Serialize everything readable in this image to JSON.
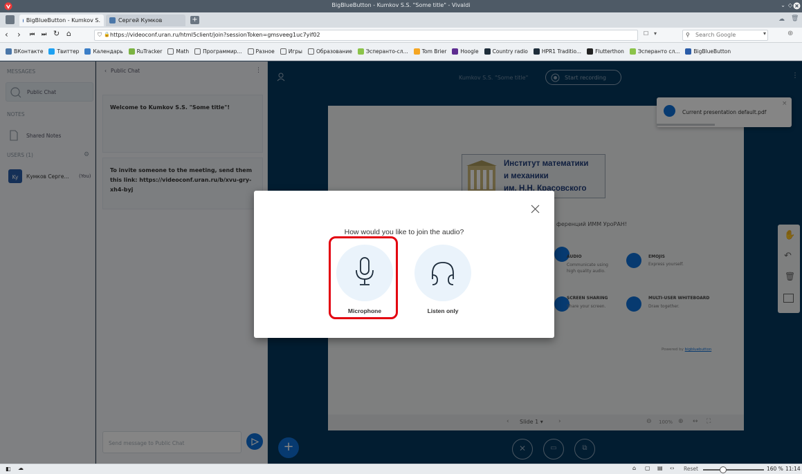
{
  "window": {
    "title": "BigBlueButton - Kumkov S.S. \"Some title\" - Vivaldi"
  },
  "tabs": [
    {
      "label": "BigBlueButton - Kumkov S.",
      "active": true
    },
    {
      "label": "Сергей Кумков",
      "active": false
    }
  ],
  "address": {
    "url": "https://videoconf.uran.ru/html5client/join?sessionToken=gmsveeg1uc7yif02",
    "search_placeholder": "Search Google"
  },
  "bookmarks": [
    {
      "label": "ВКонтакте",
      "color": "#4a76a8"
    },
    {
      "label": "Твиттер",
      "color": "#1da1f2"
    },
    {
      "label": "Календарь",
      "color": "#3b7ec7"
    },
    {
      "label": "RuTracker",
      "color": "#7bb342"
    },
    {
      "label": "Math",
      "color": "folder"
    },
    {
      "label": "Программир...",
      "color": "folder"
    },
    {
      "label": "Разное",
      "color": "folder"
    },
    {
      "label": "Игры",
      "color": "folder"
    },
    {
      "label": "Образование",
      "color": "folder"
    },
    {
      "label": "Эсперанто-сл...",
      "color": "#8bc34a"
    },
    {
      "label": "Tom Brier",
      "color": "#f5a623"
    },
    {
      "label": "Hoogle",
      "color": "#5e2d91"
    },
    {
      "label": "Country radio",
      "color": "#1e2d3a"
    },
    {
      "label": "HPR1 Traditio...",
      "color": "#1e2d3a"
    },
    {
      "label": "Flutterthon",
      "color": "#222222"
    },
    {
      "label": "Эсперанто сл...",
      "color": "#8bc34a"
    },
    {
      "label": "BigBlueButton",
      "color": "#2a5ca8"
    }
  ],
  "sidebar": {
    "messages_heading": "MESSAGES",
    "public_chat_label": "Public Chat",
    "notes_heading": "NOTES",
    "shared_notes_label": "Shared Notes",
    "users_heading": "USERS (1)",
    "user_avatar_text": "Ky",
    "user_name": "Кумков Серге...",
    "user_you": "(You)"
  },
  "chat": {
    "back_label": "Public Chat",
    "welcome_prefix": "Welcome to ",
    "welcome_title": "Kumkov S.S. \"Some title\"",
    "welcome_suffix": "!",
    "invite_text": "To invite someone to the meeting, send them this link: https://videoconf.uran.ru/b/xvu-gry-xh4-byj",
    "input_placeholder": "Send message to Public Chat"
  },
  "main": {
    "meeting_title": "Kumkov S.S. \"Some title\"",
    "recording_label": "Start recording",
    "slide_label": "Slide 1",
    "zoom_value": "100%"
  },
  "slide": {
    "institute_line1": "Институт математики",
    "institute_line2": "и механики",
    "institute_line3": "им. Н.Н. Красовского",
    "conference_text": "ференций ИММ УроРАН!",
    "features": [
      {
        "title": "AUDIO",
        "desc": "Communicate using high quality audio."
      },
      {
        "title": "EMOJIS",
        "desc": "Express yourself."
      },
      {
        "title": "SCREEN SHARING",
        "desc": "Share your screen."
      },
      {
        "title": "MULTI-USER WHITEBOARD",
        "desc": "Draw together."
      }
    ],
    "powered_by": "Powered by",
    "powered_link": "bigbluebutton"
  },
  "toast": {
    "text": "Current presentation default.pdf"
  },
  "audio_modal": {
    "question": "How would you like to join the audio?",
    "microphone_label": "Microphone",
    "listen_only_label": "Listen only"
  },
  "statusbar": {
    "reset_label": "Reset",
    "zoom_level": "160 %",
    "time": "11:14"
  },
  "colors": {
    "accent": "#0f70d7",
    "highlight": "#e3000f",
    "bg_dark": "#04385e"
  }
}
